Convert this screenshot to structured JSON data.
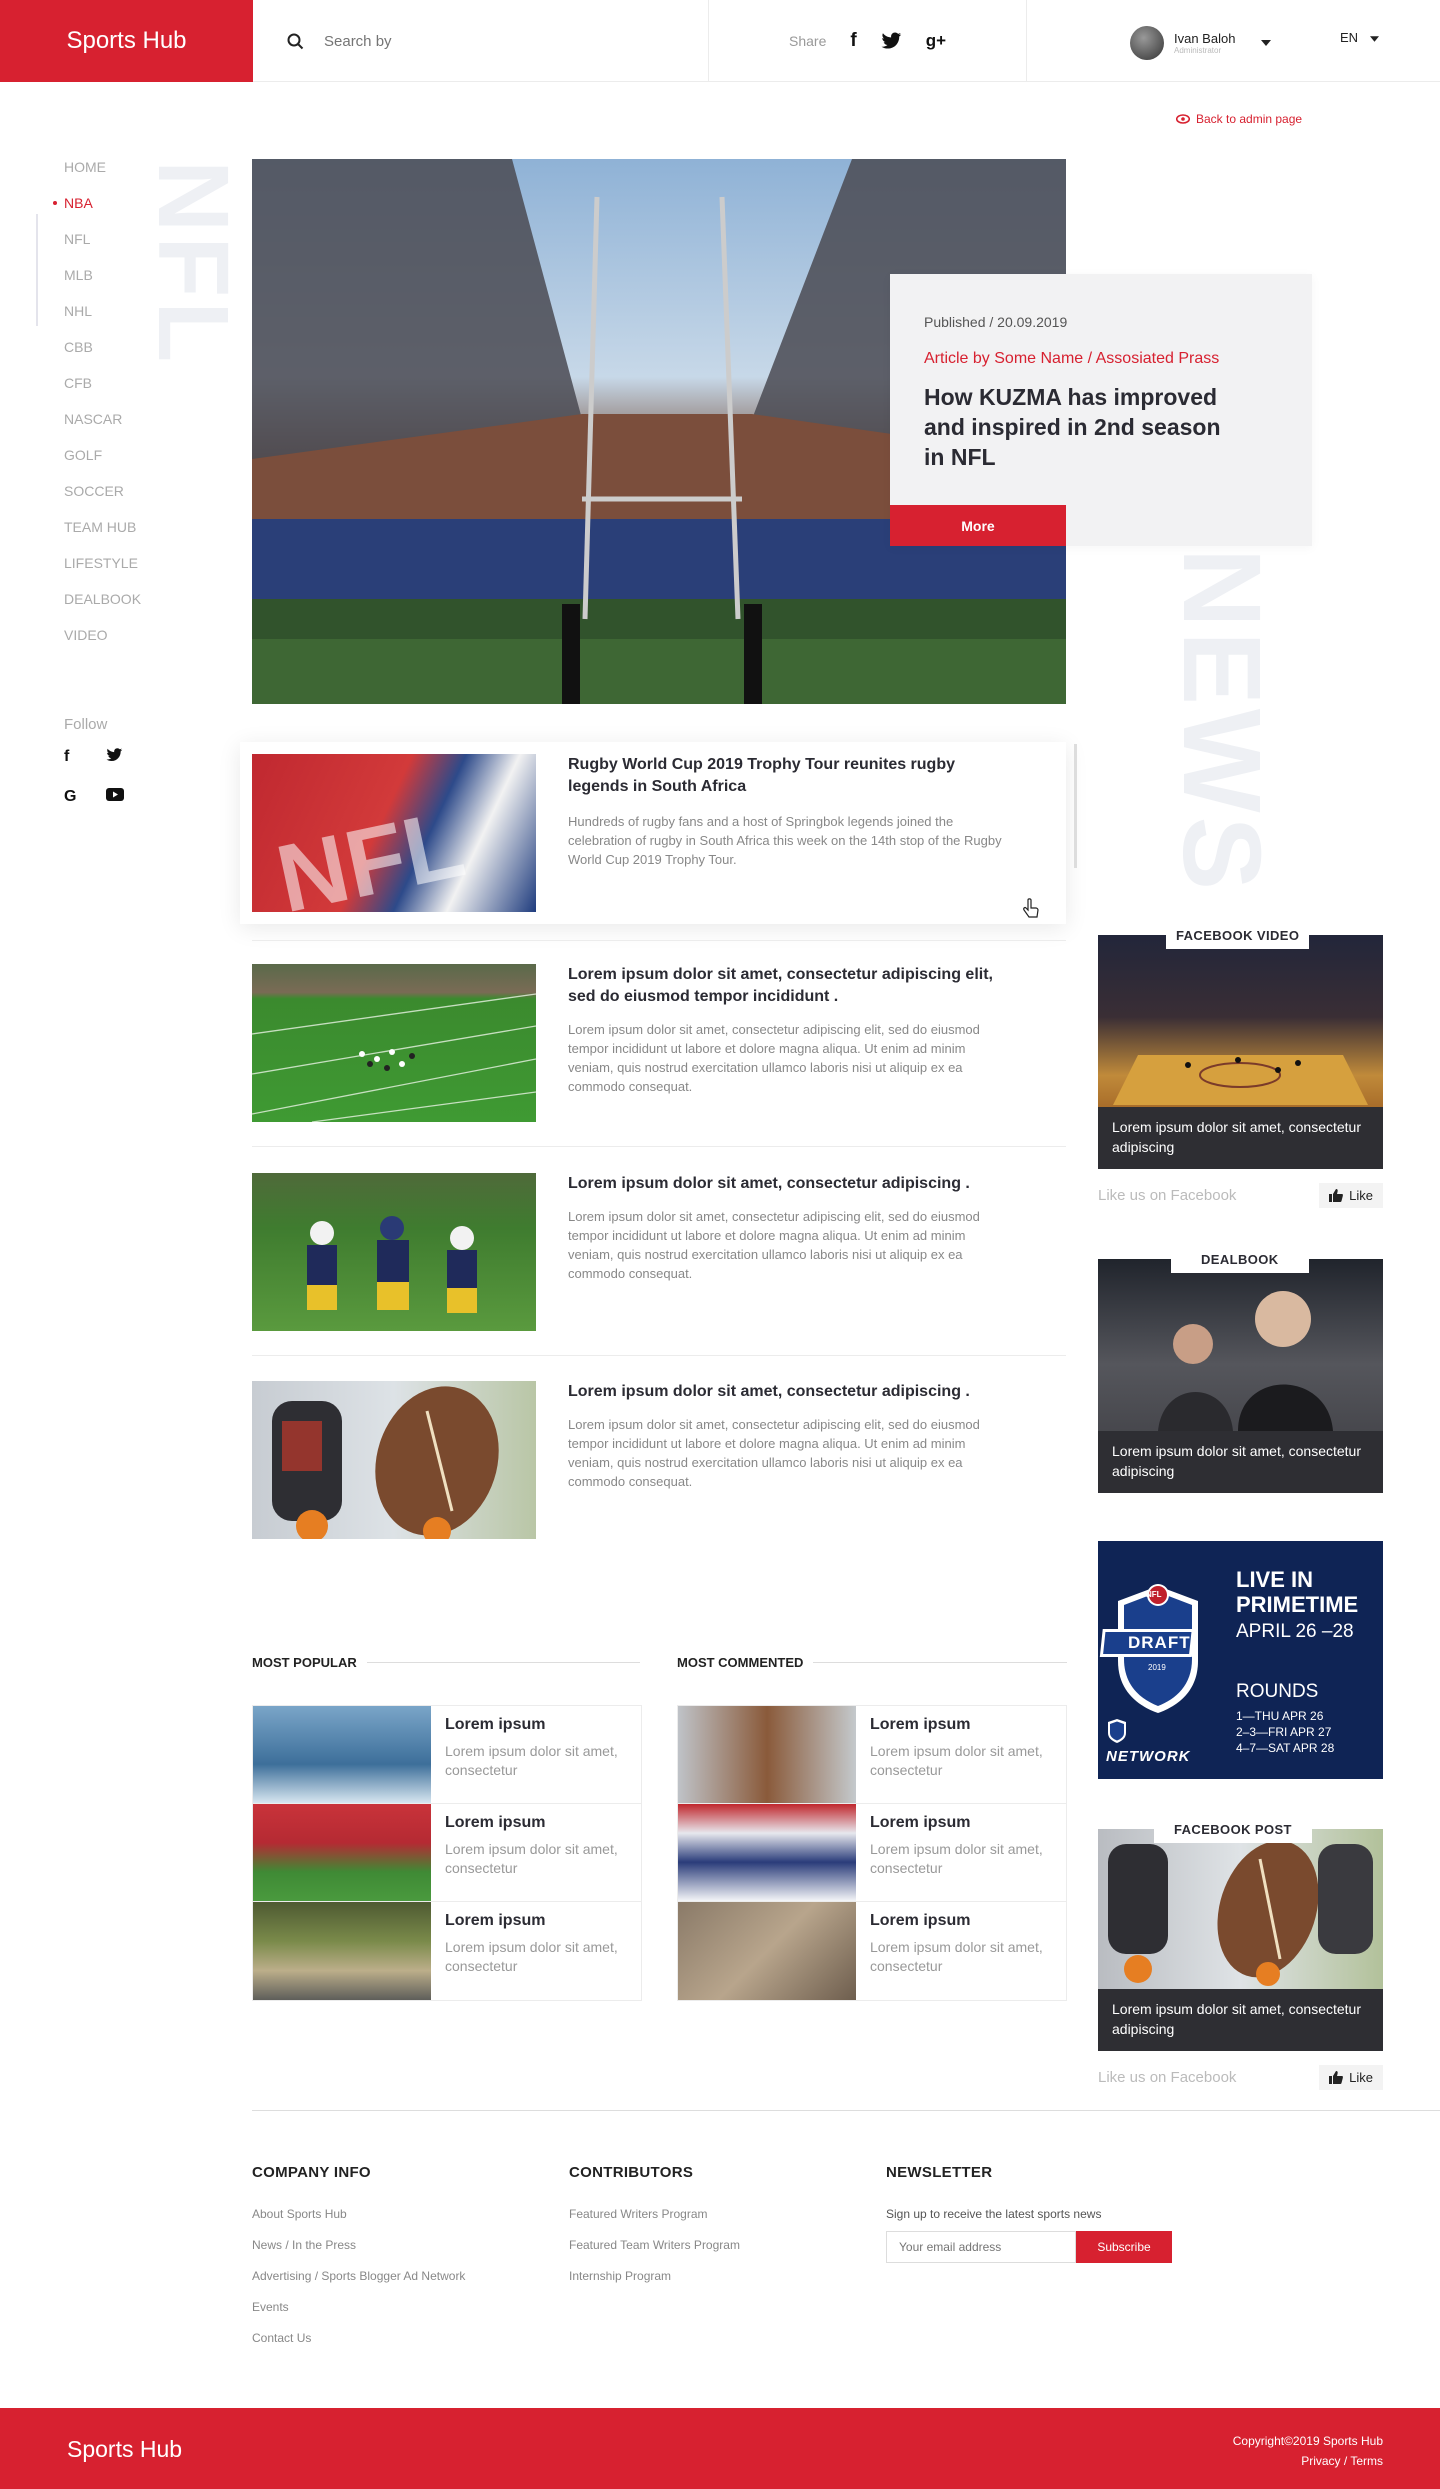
{
  "header": {
    "logo": "Sports Hub",
    "search_placeholder": "Search by",
    "share_label": "Share",
    "user_name": "Ivan Baloh",
    "user_role": "Administrator",
    "lang": "EN"
  },
  "back_link": "Back to admin page",
  "sidebar": {
    "items": [
      "HOME",
      "NBA",
      "NFL",
      "MLB",
      "NHL",
      "CBB",
      "CFB",
      "NASCAR",
      "GOLF",
      "SOCCER",
      "TEAM HUB",
      "LIFESTYLE",
      "DEALBOOK",
      "VIDEO"
    ],
    "active": "NBA",
    "follow": "Follow"
  },
  "hero": {
    "vertical_left": "NFL",
    "vertical_right": "NEWS",
    "published": "Published / 20.09.2019",
    "byline": "Article by Some Name / Assosiated Prass",
    "title": "How KUZMA has improved and inspired in 2nd season in NFL",
    "more": "More"
  },
  "articles": [
    {
      "title": "Rugby World Cup 2019 Trophy Tour reunites rugby legends in South Africa",
      "text": "Hundreds of rugby fans and a host of Springbok legends joined the celebration of rugby in South Africa this week on the 14th stop of the Rugby World Cup 2019 Trophy Tour."
    },
    {
      "title": "Lorem ipsum dolor sit amet, consectetur adipiscing elit, sed do eiusmod tempor incididunt .",
      "text": "Lorem ipsum dolor sit amet, consectetur adipiscing elit, sed do eiusmod tempor incididunt ut labore et dolore magna aliqua. Ut enim ad minim veniam, quis nostrud exercitation ullamco laboris nisi ut aliquip ex ea commodo consequat."
    },
    {
      "title": "Lorem ipsum dolor sit amet, consectetur adipiscing .",
      "text": "Lorem ipsum dolor sit amet, consectetur adipiscing elit, sed do eiusmod tempor incididunt ut labore et dolore magna aliqua. Ut enim ad minim veniam, quis nostrud exercitation ullamco laboris nisi ut aliquip ex ea commodo consequat."
    },
    {
      "title": "Lorem ipsum dolor sit amet, consectetur adipiscing .",
      "text": "Lorem ipsum dolor sit amet, consectetur adipiscing elit, sed do eiusmod tempor incididunt ut labore et dolore magna aliqua. Ut enim ad minim veniam, quis nostrud exercitation ullamco laboris nisi ut aliquip ex ea commodo consequat."
    }
  ],
  "right": {
    "fb_video_tag": "FACEBOOK  VIDEO",
    "fb_video_text": "Lorem ipsum dolor sit amet, consectetur adipiscing",
    "like_us": "Like us on Facebook",
    "like": "Like",
    "dealbook_tag": "DEALBOOK",
    "dealbook_text": "Lorem ipsum dolor sit amet, consectetur adipiscing",
    "draft": {
      "logo_top": "NFL",
      "logo_main": "DRAFT",
      "logo_year": "2019",
      "headline1": "LIVE IN",
      "headline2": "PRIMETIME",
      "dates": "APRIL 26 –28",
      "rounds": "ROUNDS",
      "r1": "1—THU APR 26",
      "r2": "2–3—FRI APR 27",
      "r3": "4–7—SAT APR 28",
      "network": "NETWORK"
    },
    "fb_post_tag": "FACEBOOK POST",
    "fb_post_text": "Lorem ipsum dolor sit amet, consectetur adipiscing"
  },
  "most_popular": {
    "heading": "MOST POPULAR",
    "items": [
      {
        "title": "Lorem ipsum",
        "text": "Lorem ipsum dolor sit amet, consectetur"
      },
      {
        "title": "Lorem ipsum",
        "text": "Lorem ipsum dolor sit amet, consectetur"
      },
      {
        "title": "Lorem ipsum",
        "text": "Lorem ipsum dolor sit amet, consectetur"
      }
    ]
  },
  "most_commented": {
    "heading": "MOST COMMENTED",
    "items": [
      {
        "title": "Lorem ipsum",
        "text": "Lorem ipsum dolor sit amet, consectetur"
      },
      {
        "title": "Lorem ipsum",
        "text": "Lorem ipsum dolor sit amet, consectetur"
      },
      {
        "title": "Lorem ipsum",
        "text": "Lorem ipsum dolor sit amet, consectetur"
      }
    ]
  },
  "footer": {
    "company": {
      "heading": "COMPANY INFO",
      "links": [
        "About Sports Hub",
        "News / In the Press",
        "Advertising / Sports Blogger Ad Network",
        "Events",
        "Contact Us"
      ]
    },
    "contributors": {
      "heading": "CONTRIBUTORS",
      "links": [
        "Featured Writers Program",
        "Featured Team Writers Program",
        "Internship Program"
      ]
    },
    "newsletter": {
      "heading": "NEWSLETTER",
      "text": "Sign up to receive the latest sports news",
      "placeholder": "Your email address",
      "button": "Subscribe"
    },
    "bottom_logo": "Sports Hub",
    "copyright": "Copyright©2019 Sports Hub",
    "privacy": "Privacy / Terms"
  },
  "colors": {
    "brand_red": "#d72130",
    "dark": "#2e2e33"
  }
}
